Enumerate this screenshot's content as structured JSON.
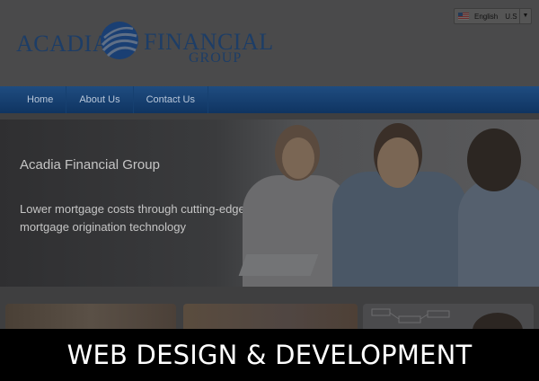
{
  "header": {
    "logo_left": "ACADIA",
    "logo_right": "FINANCIAL",
    "logo_sub": "GROUP",
    "language": {
      "label": "English",
      "region": "U.S",
      "arrow": "▼"
    }
  },
  "nav": {
    "items": [
      "Home",
      "About Us",
      "Contact Us"
    ]
  },
  "hero": {
    "title": "Acadia Financial Group",
    "subtitle": "Lower mortgage costs through cutting-edge mortgage origination technology"
  },
  "banner": {
    "text": "WEB DESIGN & DEVELOPMENT"
  },
  "colors": {
    "brand_navy": "#1d3d66",
    "nav_blue": "#1f4c80",
    "banner_bg": "#000000",
    "banner_text": "#ffffff"
  },
  "icons": {
    "language_flag": "us-flag-icon",
    "dropdown": "chevron-down-icon",
    "logo_mark": "globe-logo-icon"
  }
}
